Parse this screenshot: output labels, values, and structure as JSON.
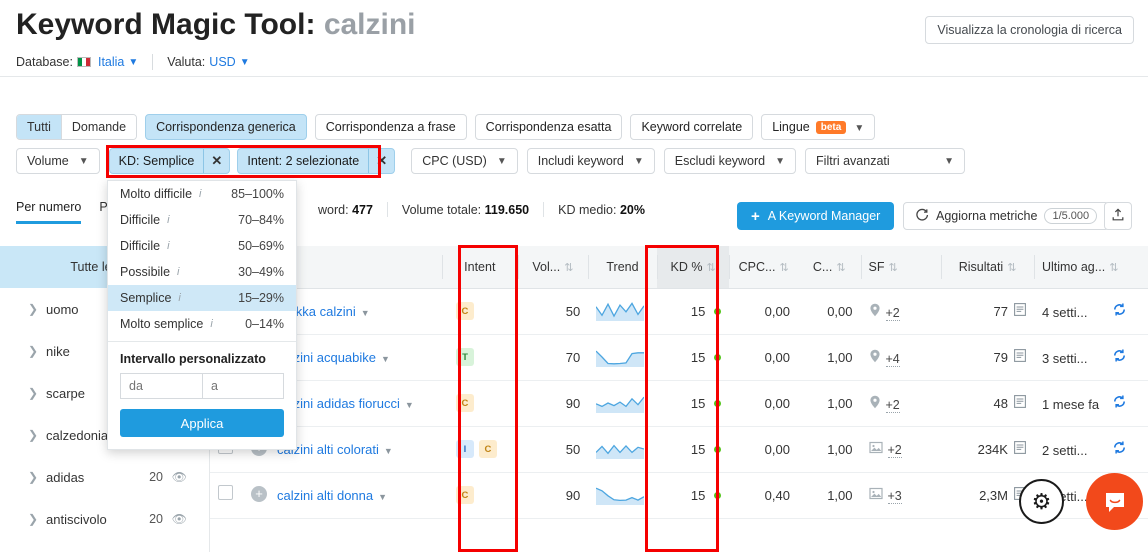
{
  "header": {
    "title_main": "Keyword Magic Tool:",
    "title_keyword": "calzini",
    "history_button": "Visualizza la cronologia di ricerca",
    "database_label": "Database:",
    "database_value": "Italia",
    "currency_label": "Valuta:",
    "currency_value": "USD"
  },
  "match_tabs": {
    "group": [
      {
        "label": "Tutti",
        "active": true
      },
      {
        "label": "Domande",
        "active": false
      }
    ],
    "standalone": [
      {
        "label": "Corrispondenza generica",
        "active": true
      },
      {
        "label": "Corrispondenza a frase",
        "active": false
      },
      {
        "label": "Corrispondenza esatta",
        "active": false
      },
      {
        "label": "Keyword correlate",
        "active": false
      }
    ],
    "lingue": {
      "label": "Lingue",
      "badge": "beta"
    }
  },
  "filters": {
    "volume": "Volume",
    "kd_chip": "KD: Semplice",
    "intent_chip": "Intent: 2 selezionate",
    "cpc": "CPC (USD)",
    "includi": "Includi keyword",
    "escludi": "Escludi keyword",
    "avanzati": "Filtri avanzati",
    "close_glyph": "✕"
  },
  "kd_dropdown": {
    "options": [
      {
        "label": "Molto difficile",
        "range": "85–100%",
        "selected": false
      },
      {
        "label": "Difficile",
        "range": "70–84%",
        "selected": false
      },
      {
        "label": "Difficile",
        "range": "50–69%",
        "selected": false
      },
      {
        "label": "Possibile",
        "range": "30–49%",
        "selected": false
      },
      {
        "label": "Semplice",
        "range": "15–29%",
        "selected": true
      },
      {
        "label": "Molto semplice",
        "range": "0–14%",
        "selected": false
      }
    ],
    "custom_title": "Intervallo personalizzato",
    "from_placeholder": "da",
    "to_placeholder": "a",
    "apply_label": "Applica",
    "info_glyph": "i"
  },
  "toolbar": {
    "tabs": [
      {
        "label": "Per numero",
        "active": true
      },
      {
        "label": "Pe",
        "active": false
      }
    ],
    "stats": [
      {
        "label": "word:",
        "value": "477"
      },
      {
        "label": "Volume totale:",
        "value": "119.650"
      },
      {
        "label": "KD medio:",
        "value": "20%"
      }
    ],
    "keyword_manager": "A Keyword Manager",
    "refresh_metrics": "Aggiorna metriche",
    "refresh_count": "1/5.000"
  },
  "sidebar": {
    "header": "Tutte le ke...",
    "items": [
      {
        "label": "uomo",
        "count": "",
        "has_eye": false
      },
      {
        "label": "nike",
        "count": "",
        "has_eye": false
      },
      {
        "label": "scarpe",
        "count": "",
        "has_eye": false
      },
      {
        "label": "calzedonia",
        "count": "",
        "has_eye": false
      },
      {
        "label": "adidas",
        "count": "20",
        "has_eye": true
      },
      {
        "label": "antiscivolo",
        "count": "20",
        "has_eye": true
      }
    ]
  },
  "table": {
    "columns": [
      {
        "label": "eyword",
        "sortable": true
      },
      {
        "label": "Intent",
        "sortable": false
      },
      {
        "label": "Vol...",
        "sortable": true
      },
      {
        "label": "Trend",
        "sortable": false
      },
      {
        "label": "KD %",
        "sortable": true,
        "selected": true
      },
      {
        "label": "CPC...",
        "sortable": true
      },
      {
        "label": "C...",
        "sortable": true
      },
      {
        "label": "SF",
        "sortable": true
      },
      {
        "label": "Risultati",
        "sortable": true
      },
      {
        "label": "Ultimo ag...",
        "sortable": true
      }
    ],
    "rows": [
      {
        "keyword": "brekka calzini",
        "intents": [
          "C"
        ],
        "volume": "50",
        "trend": [
          0.75,
          0.25,
          0.9,
          0.2,
          0.85,
          0.45,
          0.95,
          0.3,
          0.8
        ],
        "kd": "15",
        "cpc": "0,00",
        "com": "0,00",
        "sf_icon": "location-icon",
        "sf": "+2",
        "risultati": "77",
        "ultimo": "4 setti..."
      },
      {
        "keyword": "calzini acquabike",
        "intents": [
          "T"
        ],
        "volume": "70",
        "trend": [
          0.85,
          0.5,
          0.12,
          0.1,
          0.12,
          0.15,
          0.7,
          0.75,
          0.75
        ],
        "kd": "15",
        "cpc": "0,00",
        "com": "1,00",
        "sf_icon": "location-icon",
        "sf": "+4",
        "risultati": "79",
        "ultimo": "3 setti..."
      },
      {
        "keyword": "calzini adidas fiorucci",
        "intents": [
          "C"
        ],
        "volume": "90",
        "trend": [
          0.45,
          0.3,
          0.5,
          0.35,
          0.55,
          0.3,
          0.75,
          0.4,
          0.85
        ],
        "kd": "15",
        "cpc": "0,00",
        "com": "1,00",
        "sf_icon": "location-icon",
        "sf": "+2",
        "risultati": "48",
        "ultimo": "1 mese fa"
      },
      {
        "keyword": "calzini alti colorati",
        "intents": [
          "I",
          "C"
        ],
        "volume": "50",
        "trend": [
          0.3,
          0.65,
          0.25,
          0.7,
          0.3,
          0.68,
          0.3,
          0.6,
          0.5
        ],
        "kd": "15",
        "cpc": "0,00",
        "com": "1,00",
        "sf_icon": "image-icon",
        "sf": "+2",
        "risultati": "234K",
        "ultimo": "2 setti..."
      },
      {
        "keyword": "calzini alti donna",
        "intents": [
          "C"
        ],
        "volume": "90",
        "trend": [
          0.9,
          0.75,
          0.45,
          0.22,
          0.18,
          0.2,
          0.35,
          0.2,
          0.4
        ],
        "kd": "15",
        "cpc": "0,40",
        "com": "1,00",
        "sf_icon": "image-icon",
        "sf": "+3",
        "risultati": "2,3M",
        "ultimo": "2 setti..."
      }
    ]
  },
  "colors": {
    "accent_blue": "#1f9bde",
    "link_blue": "#1f7ae0",
    "chip_blue": "#c4e4f7",
    "annotation_red": "#f50000",
    "kd_dot_green": "#52c41a",
    "beta_orange": "#ff7a29",
    "chat_orange": "#f2491b"
  }
}
